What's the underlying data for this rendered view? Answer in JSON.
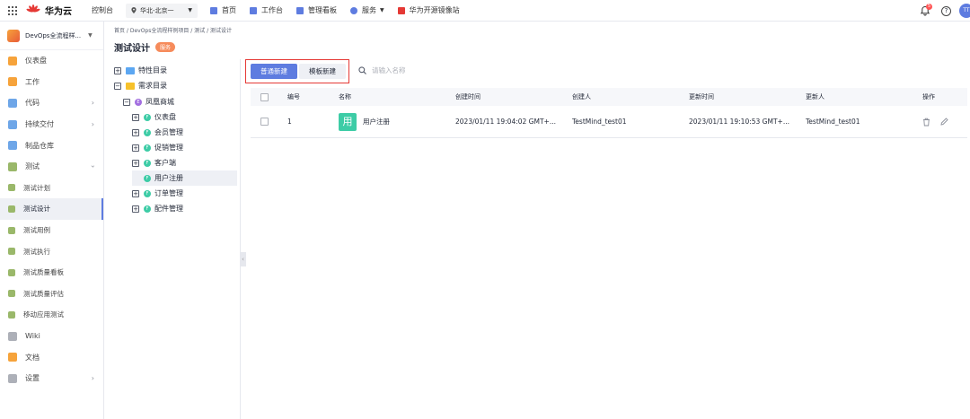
{
  "topbar": {
    "brand": "华为云",
    "console": "控制台",
    "region": "华北-北京一",
    "nav": [
      {
        "label": "首页",
        "icon": "home-icon",
        "color": "#5e7ce0"
      },
      {
        "label": "工作台",
        "icon": "workbench-icon",
        "color": "#5e7ce0"
      },
      {
        "label": "管理看板",
        "icon": "dashboard-icon",
        "color": "#5e7ce0"
      },
      {
        "label": "服务",
        "icon": "service-icon",
        "color": "#5e7ce0"
      },
      {
        "label": "华为开源镜像站",
        "icon": "mirror-icon",
        "color": "#e53935"
      }
    ],
    "notification_count": "5",
    "help": "?",
    "avatar": "TT"
  },
  "sidebar": {
    "project": "DevOps全流程样...",
    "items": [
      {
        "label": "仪表盘",
        "color": "#f6a33b"
      },
      {
        "label": "工作",
        "color": "#f6a33b"
      },
      {
        "label": "代码",
        "color": "#6ea6e8"
      },
      {
        "label": "持续交付",
        "color": "#6ea6e8"
      },
      {
        "label": "制品仓库",
        "color": "#6ea6e8"
      },
      {
        "label": "测试",
        "color": "#9ab86a"
      },
      {
        "label": "测试计划",
        "color": "#9ab86a"
      },
      {
        "label": "测试设计",
        "color": "#9ab86a"
      },
      {
        "label": "测试用例",
        "color": "#9ab86a"
      },
      {
        "label": "测试执行",
        "color": "#9ab86a"
      },
      {
        "label": "测试质量看板",
        "color": "#9ab86a"
      },
      {
        "label": "测试质量评估",
        "color": "#9ab86a"
      },
      {
        "label": "移动应用测试",
        "color": "#9ab86a"
      },
      {
        "label": "Wiki",
        "color": "#adb0b8"
      },
      {
        "label": "文档",
        "color": "#f6a33b"
      },
      {
        "label": "设置",
        "color": "#adb0b8"
      }
    ]
  },
  "breadcrumb": {
    "path": "首页 / DevOps全流程样例项目 / 测试 / 测试设计"
  },
  "page": {
    "title": "测试设计",
    "badge": "服务"
  },
  "tree": {
    "feature_dir": "特性目录",
    "req_dir": "需求目录",
    "root": "凤凰商城",
    "root_badge": "E",
    "node_badge": "F",
    "nodes": [
      "仪表盘",
      "会员管理",
      "促销管理",
      "客户端",
      "用户注册",
      "订单管理",
      "配件管理"
    ]
  },
  "toolbar": {
    "normal_new": "普通新建",
    "template_new": "模板新建",
    "search_placeholder": "请输入名称"
  },
  "table": {
    "headers": {
      "id": "编号",
      "name": "名称",
      "created_time": "创建时间",
      "creator": "创建人",
      "updated_time": "更新时间",
      "updater": "更新人",
      "ops": "操作"
    },
    "rows": [
      {
        "id": "1",
        "icon_text": "用",
        "name": "用户注册",
        "created_time": "2023/01/11 19:04:02 GMT+...",
        "creator": "TestMind_test01",
        "updated_time": "2023/01/11 19:10:53 GMT+...",
        "updater": "TestMind_test01"
      }
    ]
  }
}
